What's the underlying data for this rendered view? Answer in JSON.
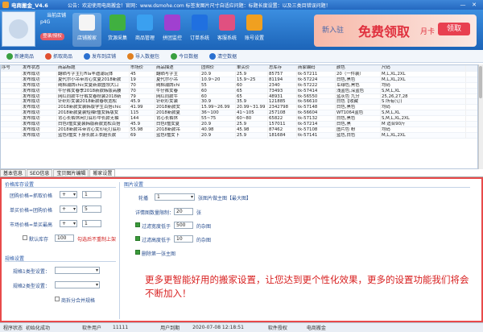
{
  "title_bar": {
    "app_title": "电商搬金_V4.6",
    "notice": "公告：欢迎使用电商搬金！官网：www.dsmohe.com 标签发图片尺寸自适应问题：标题长度设置：以及三类目错误问题！",
    "minimize": "—",
    "close": "✕"
  },
  "header": {
    "account_status": "当前店铺",
    "username": "p4G",
    "login_button": "登录/授权",
    "nav": [
      {
        "label": "店铺搬家",
        "icon": "store-move-icon",
        "color": "#f5f5f5"
      },
      {
        "label": "货源采集",
        "icon": "download-icon",
        "color": "#40b040"
      },
      {
        "label": "商品管理",
        "icon": "goods-manage-icon",
        "color": "#3aa0f0"
      },
      {
        "label": "拼团监控",
        "icon": "monitor-icon",
        "color": "#a040d0"
      },
      {
        "label": "订单系统",
        "icon": "order-icon",
        "color": "#2070e0"
      },
      {
        "label": "客服系统",
        "icon": "service-icon",
        "color": "#e05080"
      },
      {
        "label": "账号设置",
        "icon": "account-icon",
        "color": "#f0a020"
      }
    ],
    "banner": {
      "text1": "新入驻",
      "text2": "免费领取",
      "text3": "月卡",
      "button": "领取"
    }
  },
  "toolbar": {
    "items": [
      {
        "label": "新建商品",
        "icon": "new-goods-icon",
        "color": "#3aa040"
      },
      {
        "label": "抓取商品",
        "icon": "grab-icon",
        "color": "#e05030"
      },
      {
        "label": "发布到店铺",
        "icon": "publish-icon",
        "color": "#2a70d0"
      },
      {
        "label": "导入数据包",
        "icon": "import-icon",
        "color": "#e08020"
      },
      {
        "label": "今日数据",
        "icon": "today-data-icon",
        "color": "#3aa040"
      },
      {
        "label": "清空数据",
        "icon": "clear-data-icon",
        "color": "#2a70d0"
      }
    ]
  },
  "table": {
    "columns": [
      "序号",
      "发布状态",
      "商品标题",
      "市场价",
      "商品描述",
      "团购价",
      "单买价",
      "总库存",
      "商家编码",
      "颜色",
      "尺码"
    ],
    "rows": [
      [
        "",
        "发布成功",
        "翻晒写字主打Fila丰迪潮玩体",
        "45",
        "翻晒写字主",
        "20.9",
        "25.9",
        "85757",
        "tk-57211",
        "20（一件装）",
        "M,L,XL,2XL"
      ],
      [
        "",
        "发布成功",
        "夏代尔小吊带背心女夏2018新款",
        "19",
        "夏代尔小吊",
        "10.9~20",
        "15.9~25",
        "81194",
        "tk-57224",
        "白色,黑色",
        "M,L,XL,2XL"
      ],
      [
        "",
        "发布成功",
        "纯棉潮牌chic女夏新款圆领大口",
        "70",
        "纯棉潮牌chi",
        "55",
        "60",
        "2340",
        "tk-57222",
        "军绿色,黑色",
        "均码"
      ],
      [
        "",
        "发布成功",
        "牛仔裤女春季2018新款韩版高腰",
        "70",
        "牛仔裤女春",
        "60",
        "65",
        "73493",
        "tk-57414",
        "浅蓝色,深蓝色",
        "S,M,L,XL"
      ],
      [
        "",
        "发布成功",
        "网红同款牛仔裤女春秋装2018新",
        "79",
        "网红同款牛",
        "60",
        "65",
        "48931",
        "tk-56550",
        "蓝灰色 九分",
        "25,26,27,28"
      ],
      [
        "",
        "发布成功",
        "针织衫女装2018新款春秋宽松",
        "45.9",
        "针织衫女装",
        "30.9",
        "35.9",
        "121885",
        "tk-56610",
        "白色【收藏",
        "S 所有(订)"
      ],
      [
        "",
        "发布成功",
        "2018新款女装韩版学生百搭chic",
        "41.99",
        "2018新款女",
        "15.99~26.99",
        "20.99~31.99",
        "2342798",
        "tk-57148",
        "白色,黑色",
        "均码"
      ],
      [
        "",
        "发布成功",
        "2018新款夏装短袖t恤女韩版女",
        "115",
        "2018新款夏",
        "36~100",
        "41~105",
        "257108",
        "tk-56604",
        "WT1064蓝色",
        "S,M,L,XL"
      ],
      [
        "",
        "发布成功",
        "背心长裤休闲打底衫中长款无袖",
        "144",
        "背心长裤休",
        "55~75",
        "60~80",
        "65822",
        "tk-57132",
        "白色,黑色",
        "S,M,L,XL,2XL"
      ],
      [
        "",
        "发布成功",
        "白色t恤女夏装韩版新款宽松百搭",
        "45.9",
        "白色t恤女夏",
        "20.9",
        "25.9",
        "157011",
        "tk-57214",
        "白色,黑",
        "M 适合90斤"
      ],
      [
        "",
        "发布成功",
        "2018新款吊带背心女印花打底衫",
        "55.98",
        "2018新款吊",
        "40.98",
        "45.98",
        "87462",
        "tk-57108",
        "图片色 粉",
        "均码"
      ],
      [
        "",
        "发布成功",
        "蓝色t恤女下身长款上衣超长款",
        "69",
        "蓝色t恤女下",
        "20.9",
        "25.9",
        "181684",
        "tk-57141",
        "蓝色,白色",
        "M,L,XL,2XL"
      ]
    ]
  },
  "tabs": [
    "基本信息",
    "SEO信息",
    "宝贝图片编辑",
    "搬家设置"
  ],
  "active_tab": "搬家设置",
  "settings": {
    "price_section": "价格库存设置",
    "group_price_label": "团购价格=抓取价格",
    "group_price_op": "+",
    "group_price_val": "1",
    "single_price_label": "单买价格=团购价格",
    "single_price_op": "+",
    "single_price_val": "5",
    "market_price_label": "市场价格=单买最高",
    "market_price_op": "+",
    "market_price_val": "1",
    "default_stock_label": "默认库存",
    "default_stock_val": "100",
    "stock_hint": "勾选后不重制上架",
    "spec_section": "规格设置",
    "spec1_label": "规格1类型设置：",
    "spec2_label": "规格2类型设置：",
    "split_spec_label": "商拆分合并规格",
    "image_section": "图片设置",
    "carousel_label": "轮播",
    "carousel_value": "1",
    "carousel_hint": "张图片做主图【最大图】",
    "detail_limit_label": "详情图数量限制：",
    "detail_limit_val": "20",
    "detail_limit_unit": "张",
    "height_filter_label": "过滤宽度低于",
    "height_filter_val": "500",
    "height_filter_unit": "的杂图",
    "width_filter_label": "过滤高度低于",
    "width_filter_val": "10",
    "width_filter_unit": "的杂图",
    "remove_last_label": "删除第一张主图"
  },
  "promo_text": "更多更智能好用的搬家设置，让您达到更个性化效果，更多的设置功能我们将会不断加入！",
  "statusbar": {
    "left_label": "程序状态",
    "left_value": "初始化成功",
    "version_label": "软件用户",
    "user_value": "11111",
    "user_label": "用户到期",
    "date_value": "2020-07-08 12:18:51",
    "auth_label": "软件授权",
    "auth_value": "电商搬金"
  }
}
